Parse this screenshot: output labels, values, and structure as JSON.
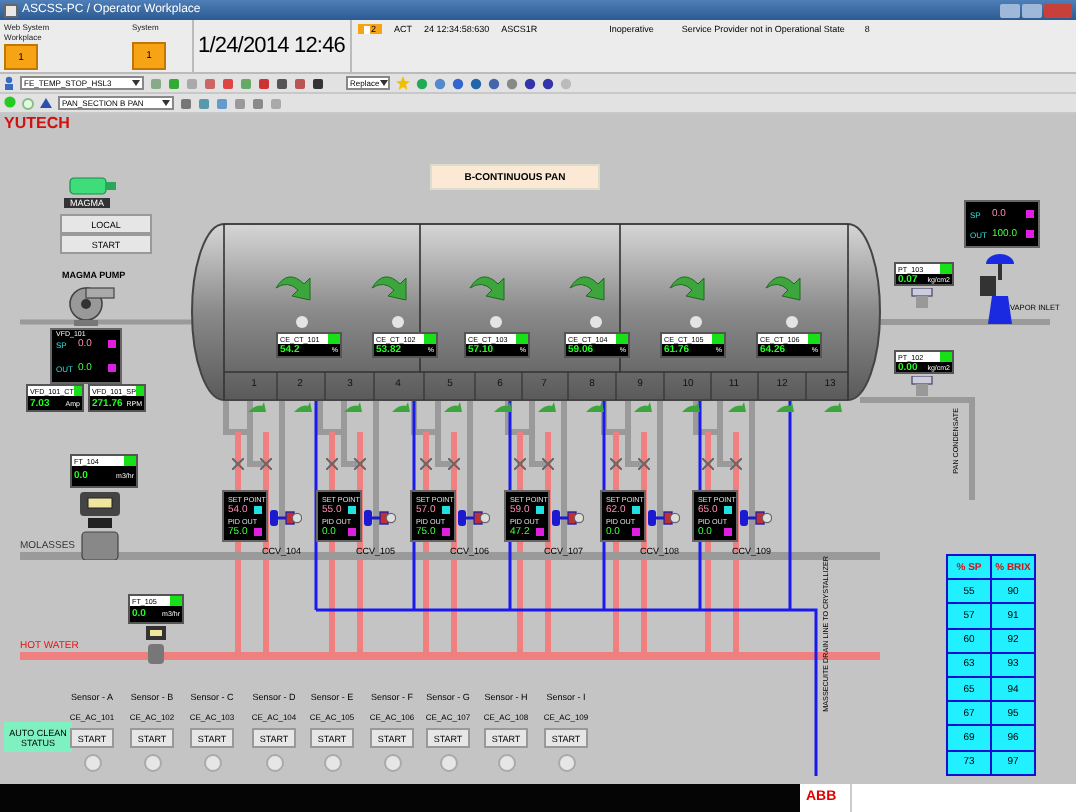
{
  "window": {
    "title": "ASCSS-PC / Operator Workplace"
  },
  "header": {
    "workplace": {
      "label": "Web System",
      "sublabel": "Workplace",
      "badge": "1"
    },
    "system": {
      "label": "System",
      "badge": "1"
    },
    "clock": "1/24/2014 12:46",
    "alarm": {
      "count": "2",
      "state": "ACT",
      "time": "24 12:34:58:630",
      "source": "ASCS1R",
      "status": "Inoperative",
      "message": "Service Provider not in Operational State",
      "priority": "8"
    }
  },
  "toolbar": {
    "object_field": "FE_TEMP_STOP_HSL3",
    "mode": "Replace",
    "display_field": "PAN_SECTION B PAN"
  },
  "brand": "YUTECH",
  "diagram": {
    "title": "B-CONTINUOUS PAN",
    "magma": {
      "label": "MAGMA",
      "buttons": [
        "LOCAL",
        "START"
      ],
      "pump_label": "MAGMA PUMP"
    },
    "pump_controller": {
      "tag": "VFD_101",
      "rows": [
        {
          "label": "SP",
          "value": "0.0"
        },
        {
          "label": "OUT",
          "value": "0.0"
        }
      ]
    },
    "pump_readouts": [
      {
        "tag": "VFD_101_CT",
        "value": "7.03",
        "unit": "Amp"
      },
      {
        "tag": "VFD_101_SP",
        "value": "271.76",
        "unit": "RPM"
      }
    ],
    "tank_readouts": [
      {
        "tag": "CE_CT_101",
        "value": "54.2",
        "unit": "%"
      },
      {
        "tag": "CE_CT_102",
        "value": "53.82",
        "unit": "%"
      },
      {
        "tag": "CE_CT_103",
        "value": "57.10",
        "unit": "%"
      },
      {
        "tag": "CE_CT_104",
        "value": "59.06",
        "unit": "%"
      },
      {
        "tag": "CE_CT_105",
        "value": "61.76",
        "unit": "%"
      },
      {
        "tag": "CE_CT_106",
        "value": "64.26",
        "unit": "%"
      }
    ],
    "sections": [
      "1",
      "2",
      "3",
      "4",
      "5",
      "6",
      "7",
      "8",
      "9",
      "10",
      "11",
      "12",
      "13"
    ],
    "flow_readouts": [
      {
        "tag": "FT_104",
        "value": "0.0",
        "unit": "m3/hr"
      },
      {
        "tag": "FT_105",
        "value": "0.0",
        "unit": "m3/hr"
      }
    ],
    "line_labels": [
      "MOLASSES",
      "HOT WATER"
    ],
    "ccv": [
      {
        "valve": "CCV_104",
        "rows": [
          {
            "label": "SET POINT",
            "value": "54.0"
          },
          {
            "label": "PID OUT",
            "value": "75.0"
          }
        ]
      },
      {
        "valve": "CCV_105",
        "rows": [
          {
            "label": "SET POINT",
            "value": "55.0"
          },
          {
            "label": "PID OUT",
            "value": "0.0"
          }
        ]
      },
      {
        "valve": "CCV_106",
        "rows": [
          {
            "label": "SET POINT",
            "value": "57.0"
          },
          {
            "label": "PID OUT",
            "value": "75.0"
          }
        ]
      },
      {
        "valve": "CCV_107",
        "rows": [
          {
            "label": "SET POINT",
            "value": "59.0"
          },
          {
            "label": "PID OUT",
            "value": "47.2"
          }
        ]
      },
      {
        "valve": "CCV_108",
        "rows": [
          {
            "label": "SET POINT",
            "value": "62.0"
          },
          {
            "label": "PID OUT",
            "value": "0.0"
          }
        ]
      },
      {
        "valve": "CCV_109",
        "rows": [
          {
            "label": "SET POINT",
            "value": "65.0"
          },
          {
            "label": "PID OUT",
            "value": "0.0"
          }
        ]
      }
    ],
    "vapor_controller": {
      "rows": [
        {
          "label": "SP",
          "value": "0.0"
        },
        {
          "label": "OUT",
          "value": "100.0"
        }
      ]
    },
    "pressure_readouts": [
      {
        "tag": "PT_103",
        "value": "0.07",
        "unit": "kg/cm2"
      },
      {
        "tag": "PT_102",
        "value": "0.00",
        "unit": "kg/cm2"
      }
    ],
    "vapor_label": "VAPOR INLET",
    "condensate_label": "PAN CONDENSATE",
    "drain_label": "MASSECUITE DRAIN LINE TO CRYSTALLIZER",
    "brix_table": {
      "columns": [
        "% SP",
        "% BRIX"
      ],
      "rows": [
        [
          "55",
          "90"
        ],
        [
          "57",
          "91"
        ],
        [
          "60",
          "92"
        ],
        [
          "63",
          "93"
        ],
        [
          "65",
          "94"
        ],
        [
          "67",
          "95"
        ],
        [
          "69",
          "96"
        ],
        [
          "73",
          "97"
        ]
      ]
    },
    "auto_clean": {
      "label": "AUTO CLEAN STATUS",
      "sensors": [
        {
          "name": "Sensor - A",
          "tag": "CE_AC_101",
          "button": "START"
        },
        {
          "name": "Sensor - B",
          "tag": "CE_AC_102",
          "button": "START"
        },
        {
          "name": "Sensor - C",
          "tag": "CE_AC_103",
          "button": "START"
        },
        {
          "name": "Sensor - D",
          "tag": "CE_AC_104",
          "button": "START"
        },
        {
          "name": "Sensor - E",
          "tag": "CE_AC_105",
          "button": "START"
        },
        {
          "name": "Sensor - F",
          "tag": "CE_AC_106",
          "button": "START"
        },
        {
          "name": "Sensor - G",
          "tag": "CE_AC_107",
          "button": "START"
        },
        {
          "name": "Sensor - H",
          "tag": "CE_AC_108",
          "button": "START"
        },
        {
          "name": "Sensor - I",
          "tag": "CE_AC_109",
          "button": "START"
        }
      ]
    }
  },
  "status_bar": {
    "logo": "ABB"
  }
}
